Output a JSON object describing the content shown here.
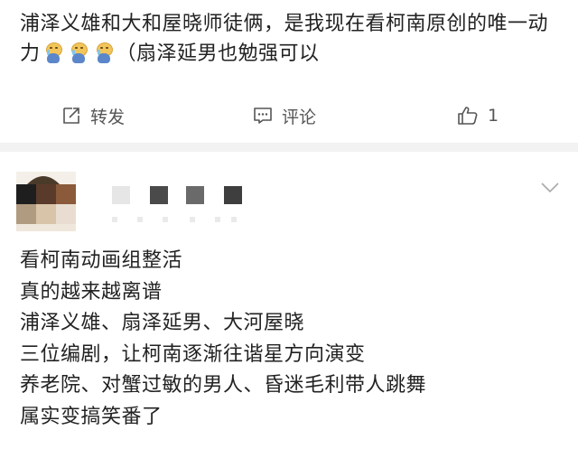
{
  "post1": {
    "text_part1": "浦泽义雄和大和屋晓师徒俩，是我现在看柯南原创的唯一动力",
    "emojis": [
      "crying-emoji",
      "crying-emoji",
      "crying-emoji"
    ],
    "text_part2": "（扇泽延男也勉强可以",
    "actions": {
      "repost_label": "转发",
      "comment_label": "评论",
      "like_count": "1"
    }
  },
  "post2": {
    "avatar_colors": [
      "#1e1e1e",
      "#5a3a2a",
      "#8a5a3a",
      "#b09a80",
      "#d8c4a8",
      "#e8ddd0"
    ],
    "lines": [
      "看柯南动画组整活",
      "真的越来越离谱",
      "浦泽义雄、扇泽延男、大河屋晓",
      "三位编剧，让柯南逐渐往谐星方向演变",
      "养老院、对蟹过敏的男人、昏迷毛利带人跳舞",
      "属实变搞笑番了"
    ]
  },
  "colors": {
    "text": "#222222",
    "action_text": "#555555",
    "divider": "#f2f2f2"
  }
}
